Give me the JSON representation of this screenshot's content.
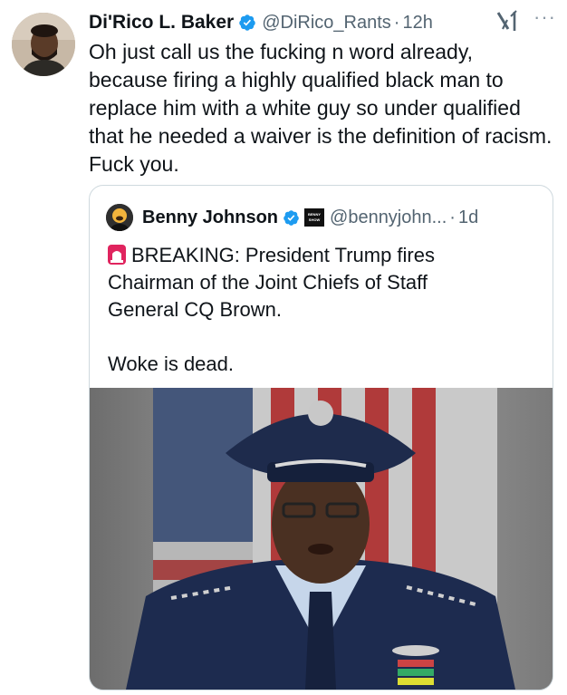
{
  "tweet": {
    "author_name": "Di'Rico L. Baker",
    "handle": "@DiRico_Rants",
    "separator": "·",
    "time": "12h",
    "more_label": "···",
    "text": "Oh just call us the fucking n word already, because firing a highly qualified black man to replace him with a white guy so under qualified that he needed a waiver is the definition of racism. Fuck you."
  },
  "quoted": {
    "author_name": "Benny Johnson",
    "badge_text": "BENNY\nSHOW",
    "handle": "@bennyjohn...",
    "separator": "·",
    "time": "1d",
    "lines": [
      "BREAKING: President Trump fires",
      "Chairman of the Joint Chiefs of Staff",
      "General CQ Brown.",
      "",
      "Woke is dead."
    ]
  },
  "icons": {
    "verified": "verified-badge-icon",
    "x": "x-logo-icon",
    "siren": "rotating-light-icon",
    "more": "more-options-icon"
  },
  "colors": {
    "text": "#0f1419",
    "secondary": "#536471",
    "verified": "#1d9bf0",
    "border": "#cfd9de",
    "siren": "#e0245e"
  }
}
